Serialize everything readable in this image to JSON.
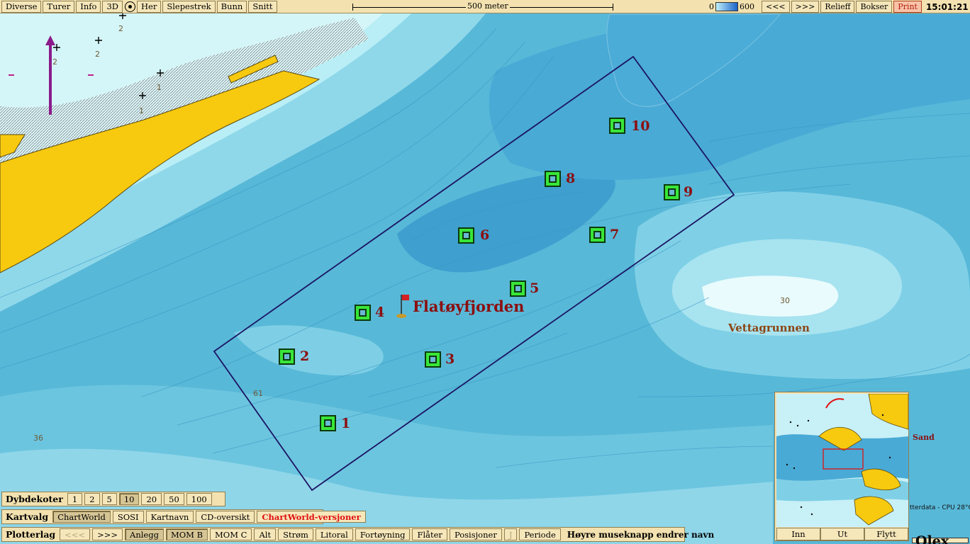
{
  "toolbar": {
    "items": [
      "Diverse",
      "Turer",
      "Info",
      "3D"
    ],
    "items2": [
      "Her",
      "Slepestrek",
      "Bunn",
      "Snitt"
    ],
    "scale_label": "500 meter",
    "depth_min": "0",
    "depth_max": "600",
    "prev": "<<<",
    "next": ">>>",
    "relief": "Relieff",
    "bokser": "Bokser",
    "print": "Print",
    "clock": "15:01:21"
  },
  "map": {
    "area_name": "Flatøyfjorden",
    "bank_name": "Vettagrunnen",
    "waypoints": [
      "1",
      "2",
      "3",
      "4",
      "5",
      "6",
      "7",
      "8",
      "9",
      "10"
    ],
    "depths": [
      "2",
      "2",
      "2",
      "1",
      "1",
      "30",
      "61",
      "36"
    ]
  },
  "panels": {
    "dybdekoter": {
      "label": "Dybdekoter",
      "buttons": [
        "1",
        "2",
        "5",
        "10",
        "20",
        "50",
        "100"
      ],
      "active": "10"
    },
    "kartvalg": {
      "label": "Kartvalg",
      "buttons": [
        "ChartWorld",
        "SOSI",
        "Kartnavn",
        "CD-oversikt",
        "ChartWorld-versjoner"
      ],
      "active": "ChartWorld"
    },
    "plotterlag": {
      "label": "Plotterlag",
      "buttons": [
        "<<<",
        ">>>",
        "Anlegg",
        "MOM B",
        "MOM C",
        "Alt",
        "Strøm",
        "Litoral",
        "Fortøyning",
        "Flåter",
        "Posisjoner",
        "J",
        "Periode"
      ],
      "hint": "Høyre museknapp endrer navn"
    }
  },
  "minimap": {
    "buttons": [
      "Inn",
      "Ut",
      "Flytt"
    ],
    "status": "tterdata - CPU 28°C",
    "sand": "Sand",
    "brand": "Olex"
  },
  "colors": {
    "land": "#f7c90f",
    "shallow": "#bff2f7",
    "mid": "#6fc8e0",
    "deep": "#3fa6d3",
    "route": "#1b1464",
    "waypoint": "#39e639",
    "label": "#8b0f0f"
  }
}
